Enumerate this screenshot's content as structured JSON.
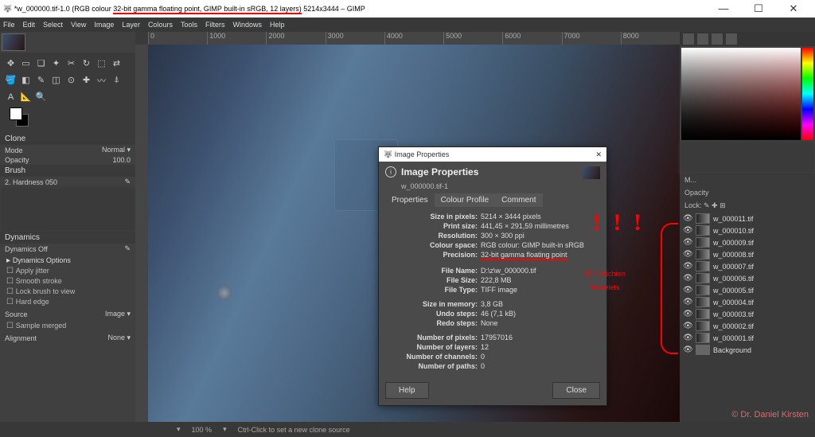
{
  "title_prefix": "*w_000000.tif-1.0 (RGB colour ",
  "title_underlined": "32-bit gamma floating point, GIMP built-in sRGB, 12 layers)",
  "title_suffix": " 5214x3444 – GIMP",
  "menu": [
    "File",
    "Edit",
    "Select",
    "View",
    "Image",
    "Layer",
    "Colours",
    "Tools",
    "Filters",
    "Windows",
    "Help"
  ],
  "ruler": [
    "0",
    "1000",
    "2000",
    "3000",
    "4000",
    "5000",
    "6000",
    "7000",
    "8000"
  ],
  "clone": {
    "title": "Clone",
    "mode_label": "Mode",
    "mode_val": "Normal",
    "opacity_label": "Opacity",
    "opacity_val": "100.0"
  },
  "brush": {
    "title": "Brush",
    "name": "2. Hardness 050"
  },
  "dyn": {
    "title": "Dynamics",
    "name": "Dynamics Off",
    "options": "Dynamics Options",
    "jitter": "Apply jitter",
    "smooth": "Smooth stroke",
    "lock": "Lock brush to view",
    "hard": "Hard edge"
  },
  "source": {
    "label": "Source",
    "val": "Image",
    "sample": "Sample merged"
  },
  "align": {
    "label": "Alignment",
    "val": "None"
  },
  "dialog": {
    "wintitle": "Image Properties",
    "heading": "Image Properties",
    "subtitle": "w_000000.tif-1",
    "tabs": [
      "Properties",
      "Colour Profile",
      "Comment"
    ],
    "props": [
      {
        "k": "Size in pixels:",
        "v": "5214 × 3444 pixels"
      },
      {
        "k": "Print size:",
        "v": "441,45 × 291,59 millimetres"
      },
      {
        "k": "Resolution:",
        "v": "300 × 300 ppi"
      },
      {
        "k": "Colour space:",
        "v": "RGB colour: GIMP built-in sRGB"
      },
      {
        "k": "Precision:",
        "v": "32-bit gamma floating point",
        "u": true
      },
      {
        "gap": true
      },
      {
        "k": "File Name:",
        "v": "D:\\z\\w_000000.tif"
      },
      {
        "k": "File Size:",
        "v": "222,8 MB"
      },
      {
        "k": "File Type:",
        "v": "TIFF image"
      },
      {
        "gap": true
      },
      {
        "k": "Size in memory:",
        "v": "3,8 GB"
      },
      {
        "k": "Undo steps:",
        "v": "46 (7,1 kB)"
      },
      {
        "k": "Redo steps:",
        "v": "None"
      },
      {
        "gap": true
      },
      {
        "k": "Number of pixels:",
        "v": "17957016"
      },
      {
        "k": "Number of layers:",
        "v": "12"
      },
      {
        "k": "Number of channels:",
        "v": "0"
      },
      {
        "k": "Number of paths:",
        "v": "0"
      }
    ],
    "help": "Help",
    "close": "Close"
  },
  "layers_header": {
    "mode": "M...",
    "opacity": "Opacity",
    "lock": "Lock: "
  },
  "layers": [
    "w_000011.tif",
    "w_000010.tif",
    "w_000009.tif",
    "w_000008.tif",
    "w_000007.tif",
    "w_000006.tif",
    "w_000005.tif",
    "w_000004.tif",
    "w_000003.tif",
    "w_000002.tif",
    "w_000001.tif",
    "Background"
  ],
  "annot": {
    "excl": "! ! !",
    "text1": "12 Schichten",
    "text2": "Wavelets"
  },
  "status": {
    "zoom": "100 %",
    "hint": "Ctrl-Click to set a new clone source"
  },
  "watermark": "© Dr. Daniel Kirsten"
}
